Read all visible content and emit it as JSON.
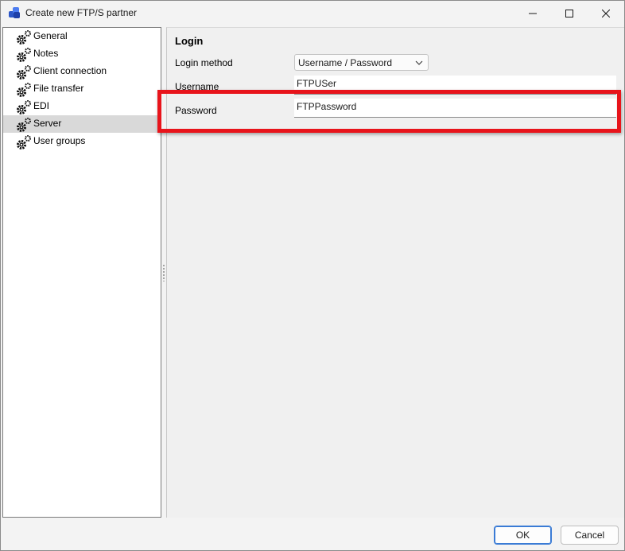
{
  "window": {
    "title": "Create new FTP/S partner",
    "controls": {
      "minimize": "minimize-icon",
      "maximize": "maximize-icon",
      "close": "close-icon"
    }
  },
  "tree": {
    "items": [
      {
        "label": "General",
        "icon": "gear-icon",
        "selected": false
      },
      {
        "label": "Notes",
        "icon": "gear-icon",
        "selected": false
      },
      {
        "label": "Client connection",
        "icon": "gear-icon",
        "selected": false
      },
      {
        "label": "File transfer",
        "icon": "gear-icon",
        "selected": false
      },
      {
        "label": "EDI",
        "icon": "gear-icon",
        "selected": false
      },
      {
        "label": "Server",
        "icon": "gear-icon",
        "selected": true
      },
      {
        "label": "User groups",
        "icon": "gear-icon",
        "selected": false
      }
    ]
  },
  "login": {
    "section_title": "Login",
    "method_label": "Login method",
    "method_value": "Username / Password",
    "username_label": "Username",
    "username_value": "FTPUSer",
    "password_label": "Password",
    "password_value": "FTPPassword"
  },
  "buttons": {
    "ok": "OK",
    "cancel": "Cancel"
  },
  "colors": {
    "highlight": "#e8141b",
    "selection": "#d9d9d9",
    "accent": "#3a7bd5"
  }
}
